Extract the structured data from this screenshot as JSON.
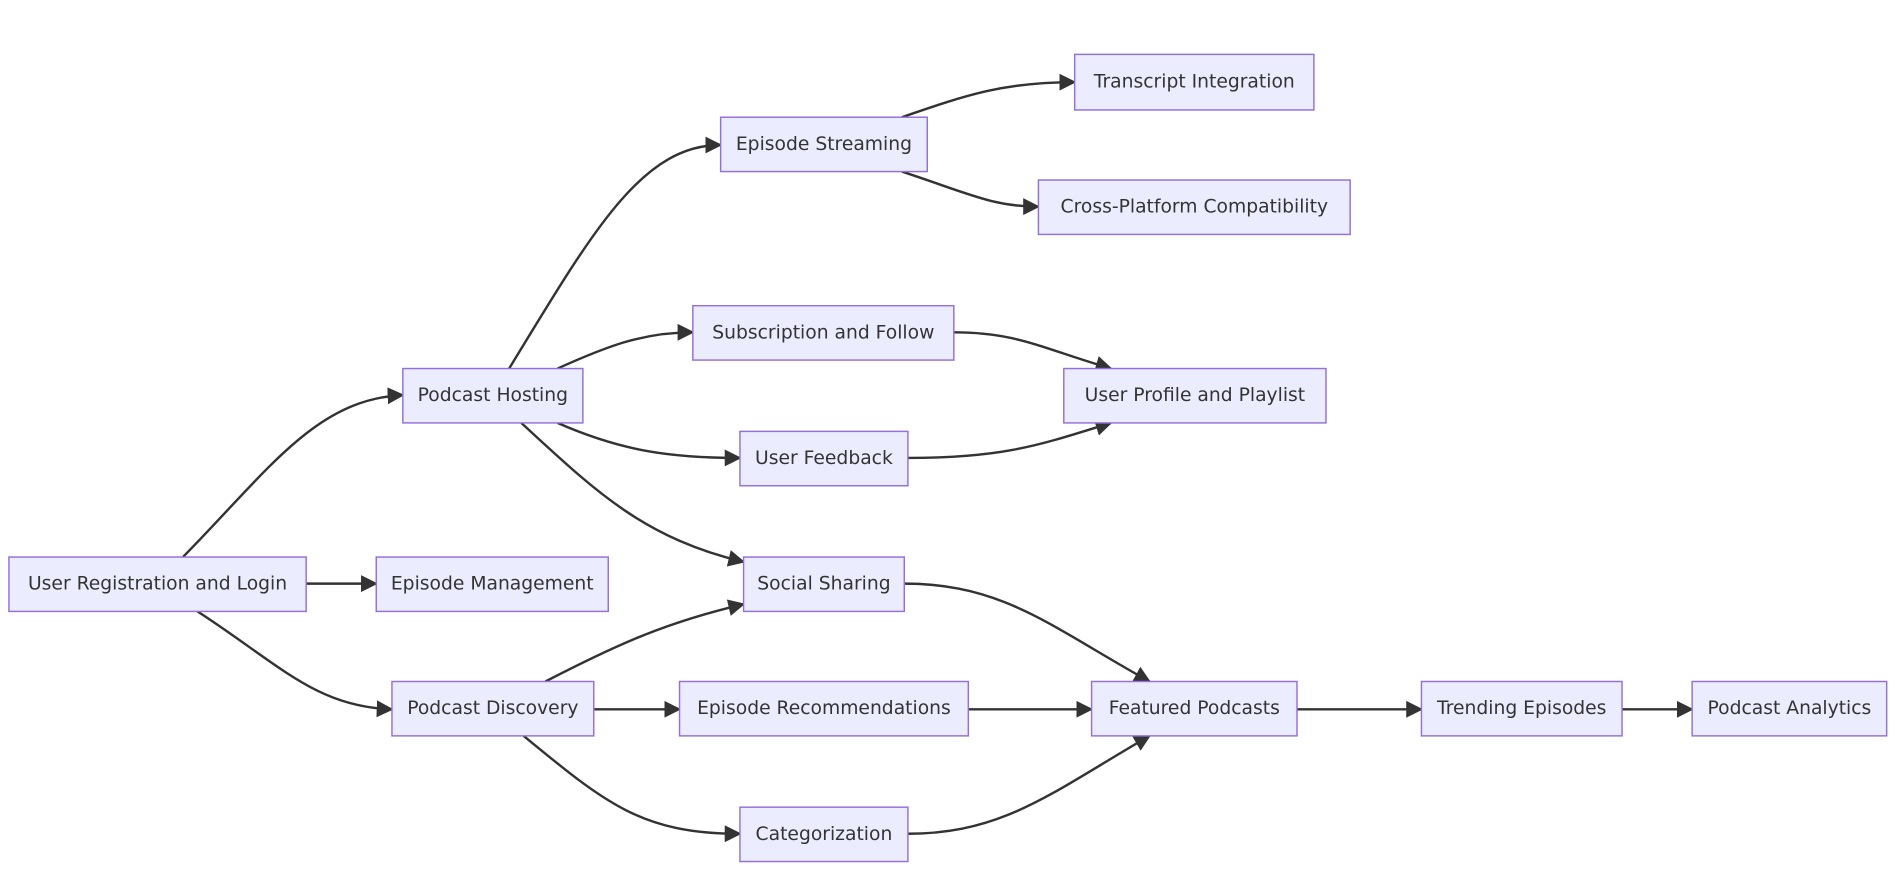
{
  "diagram": {
    "type": "flowchart",
    "direction": "left-to-right",
    "colors": {
      "node_fill": "#ECECFF",
      "node_stroke": "#9370DB",
      "edge": "#333333",
      "text": "#333333"
    },
    "nodes": [
      {
        "id": "reg",
        "label": "User Registration and Login"
      },
      {
        "id": "epmgmt",
        "label": "Episode Management"
      },
      {
        "id": "hosting",
        "label": "Podcast Hosting"
      },
      {
        "id": "discovery",
        "label": "Podcast Discovery"
      },
      {
        "id": "streaming",
        "label": "Episode Streaming"
      },
      {
        "id": "subscription",
        "label": "Subscription and Follow"
      },
      {
        "id": "feedback",
        "label": "User Feedback"
      },
      {
        "id": "social",
        "label": "Social Sharing"
      },
      {
        "id": "recommend",
        "label": "Episode Recommendations"
      },
      {
        "id": "category",
        "label": "Categorization"
      },
      {
        "id": "transcript",
        "label": "Transcript Integration"
      },
      {
        "id": "crossplat",
        "label": "Cross-Platform Compatibility"
      },
      {
        "id": "profile",
        "label": "User Profile and Playlist"
      },
      {
        "id": "featured",
        "label": "Featured Podcasts"
      },
      {
        "id": "trending",
        "label": "Trending Episodes"
      },
      {
        "id": "analytics",
        "label": "Podcast Analytics"
      }
    ],
    "edges": [
      {
        "from": "reg",
        "to": "hosting"
      },
      {
        "from": "reg",
        "to": "epmgmt"
      },
      {
        "from": "reg",
        "to": "discovery"
      },
      {
        "from": "hosting",
        "to": "streaming"
      },
      {
        "from": "hosting",
        "to": "subscription"
      },
      {
        "from": "hosting",
        "to": "feedback"
      },
      {
        "from": "hosting",
        "to": "social"
      },
      {
        "from": "streaming",
        "to": "transcript"
      },
      {
        "from": "streaming",
        "to": "crossplat"
      },
      {
        "from": "subscription",
        "to": "profile"
      },
      {
        "from": "feedback",
        "to": "profile"
      },
      {
        "from": "discovery",
        "to": "social"
      },
      {
        "from": "discovery",
        "to": "recommend"
      },
      {
        "from": "discovery",
        "to": "category"
      },
      {
        "from": "social",
        "to": "featured"
      },
      {
        "from": "recommend",
        "to": "featured"
      },
      {
        "from": "category",
        "to": "featured"
      },
      {
        "from": "featured",
        "to": "trending"
      },
      {
        "from": "trending",
        "to": "analytics"
      }
    ]
  }
}
